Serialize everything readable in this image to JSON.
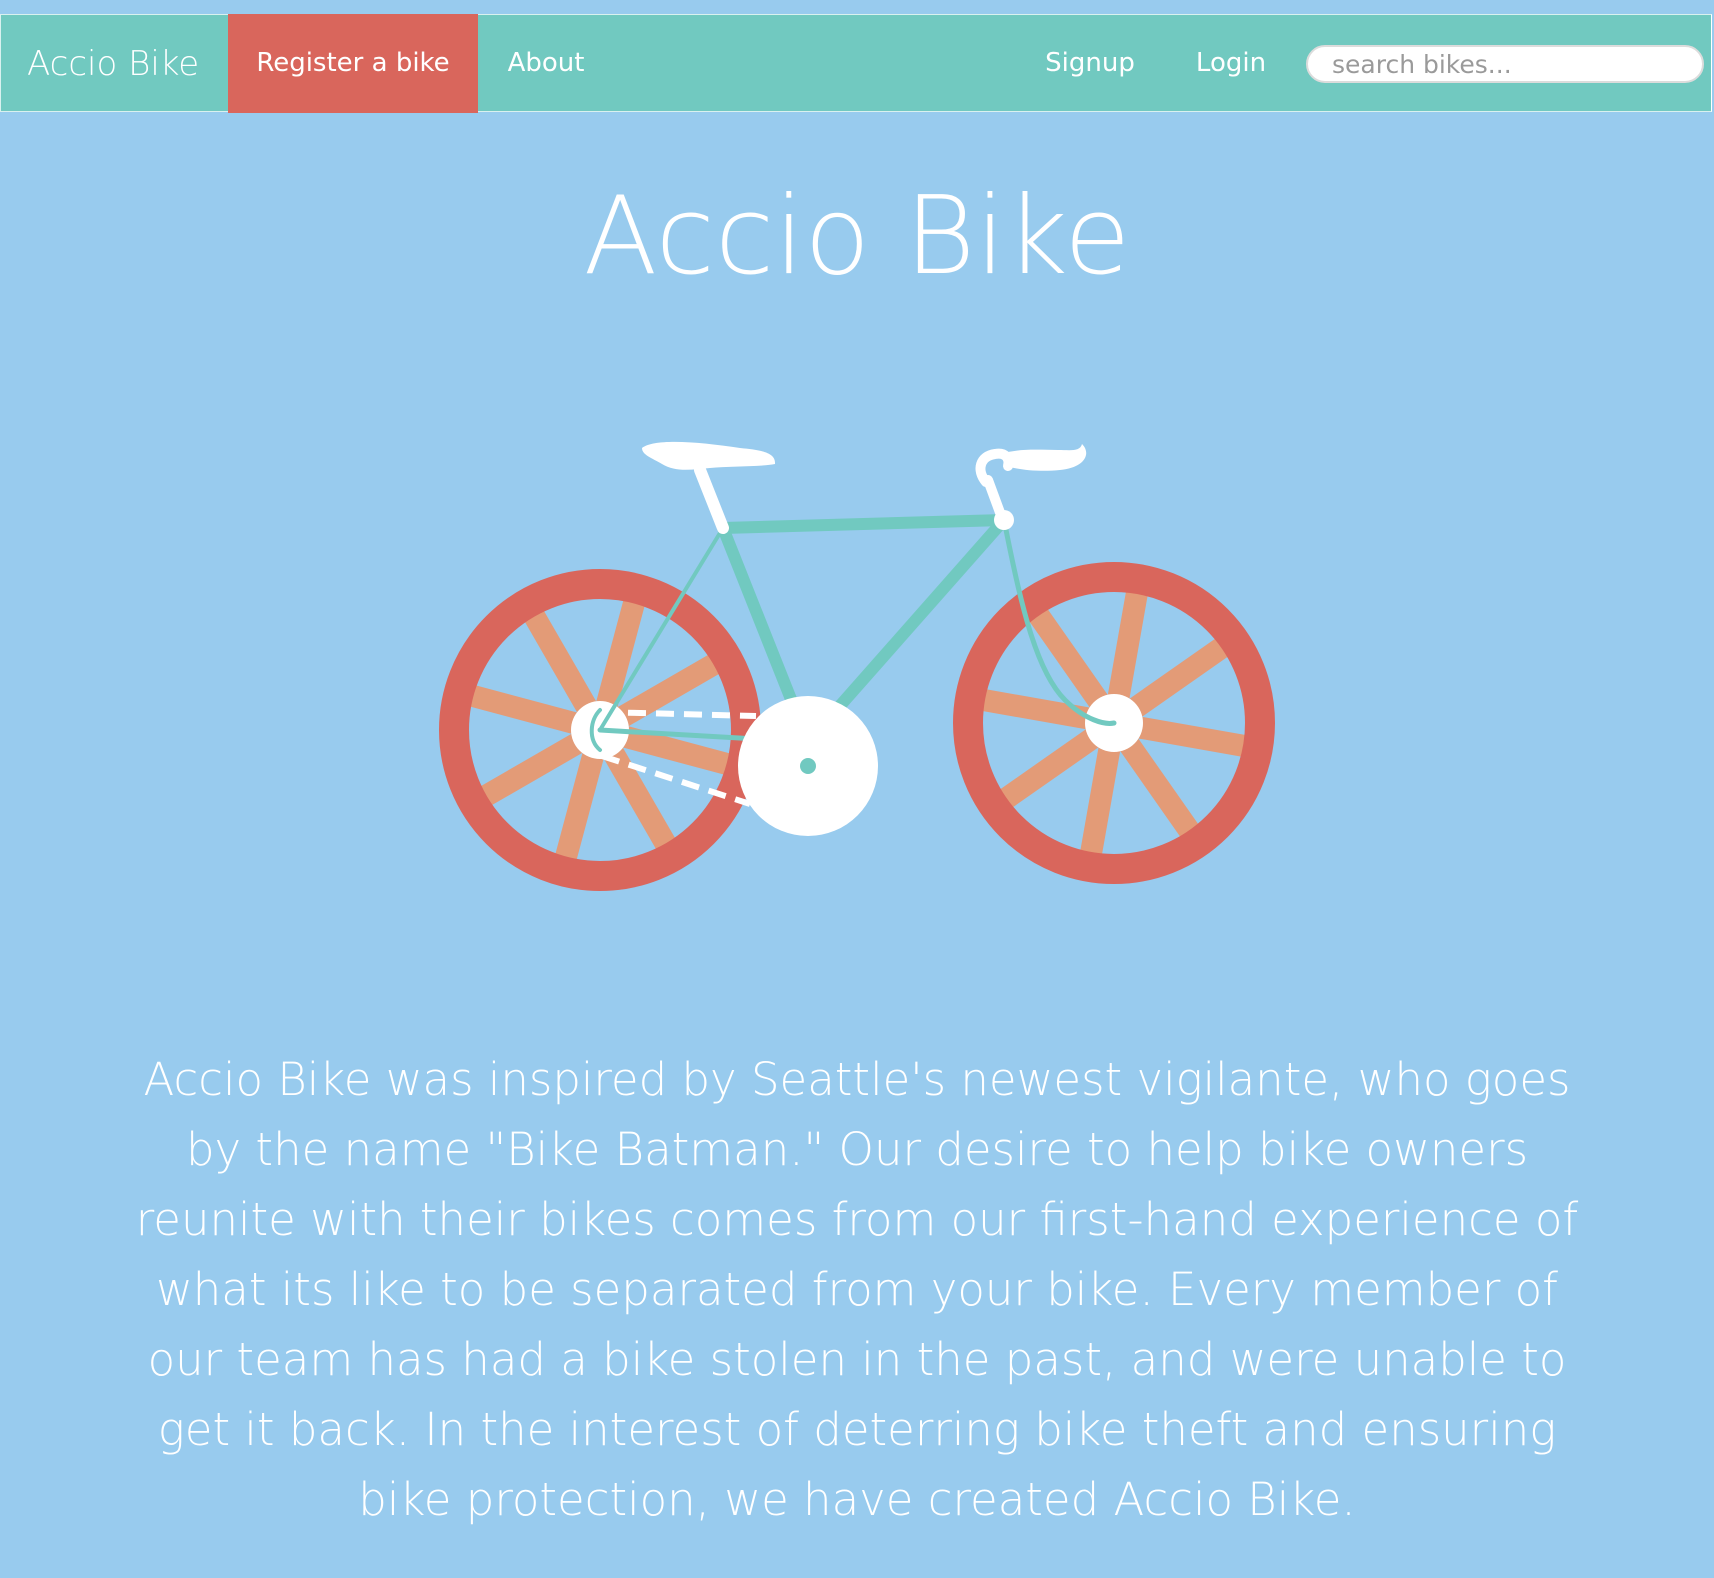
{
  "navbar": {
    "brand": "Accio Bike",
    "links": {
      "register": "Register a bike",
      "about": "About",
      "signup": "Signup",
      "login": "Login"
    },
    "search": {
      "placeholder": "search bikes...",
      "value": ""
    }
  },
  "hero": {
    "title": "Accio Bike",
    "illustration_icon": "bicycle-illustration"
  },
  "about": {
    "text": "Accio Bike was inspired by Seattle's newest vigilante, who goes by the name \"Bike Batman.\" Our desire to help bike owners reunite with their bikes comes from our first-hand experience of what its like to be separated from your bike. Every member of our team has had a bike stolen in the past, and were unable to get it back. In the interest of deterring bike theft and ensuring bike protection, we have created Accio Bike."
  },
  "colors": {
    "background": "#98cbee",
    "navbar": "#71c9c0",
    "nav_active": "#d9665c",
    "wheel_rim": "#d9665c",
    "wheel_spoke": "#e39b77",
    "frame": "#71c9c0",
    "white": "#ffffff"
  }
}
